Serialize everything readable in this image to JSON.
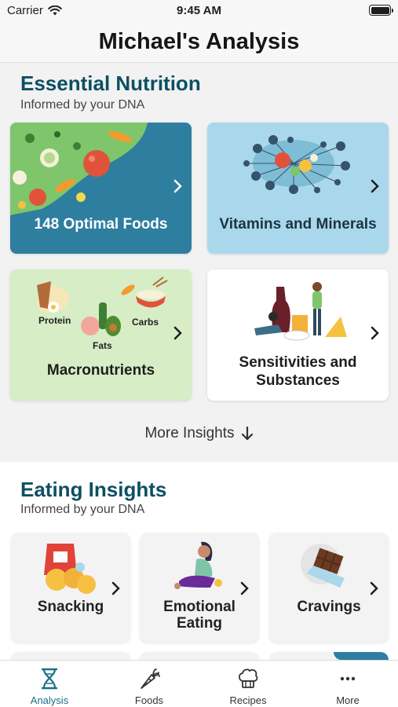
{
  "status": {
    "carrier": "Carrier",
    "time": "9:45 AM"
  },
  "header": {
    "title": "Michael's Analysis"
  },
  "essential": {
    "title": "Essential Nutrition",
    "subtitle": "Informed by your DNA",
    "cards": [
      {
        "label": "148 Optimal Foods",
        "bg": "#2e7ea0"
      },
      {
        "label": "Vitamins and Minerals",
        "bg": "#a9d8ec"
      },
      {
        "label": "Macronutrients",
        "bg": "#d6edc5",
        "tags": [
          "Protein",
          "Carbs",
          "Fats"
        ]
      },
      {
        "label": "Sensitivities and Substances",
        "bg": "#ffffff"
      }
    ],
    "more_label": "More Insights"
  },
  "eating": {
    "title": "Eating Insights",
    "subtitle": "Informed by your DNA",
    "cards": [
      {
        "label": "Snacking"
      },
      {
        "label": "Emotional Eating"
      },
      {
        "label": "Cravings"
      }
    ]
  },
  "tabs": [
    {
      "label": "Analysis",
      "icon": "hourglass-dna-icon",
      "active": true
    },
    {
      "label": "Foods",
      "icon": "carrot-icon",
      "active": false
    },
    {
      "label": "Recipes",
      "icon": "chef-hat-icon",
      "active": false
    },
    {
      "label": "More",
      "icon": "ellipsis-icon",
      "active": false
    }
  ],
  "colors": {
    "accent": "#1b6f8a",
    "title": "#0d4f63"
  }
}
